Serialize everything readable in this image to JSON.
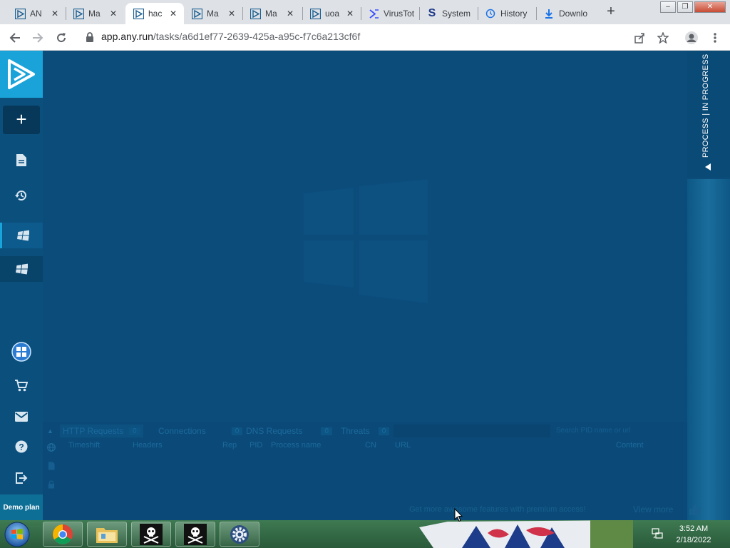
{
  "browser": {
    "tabs": [
      {
        "label": "AN",
        "icon": "anyrun-icon",
        "active": false
      },
      {
        "label": "Ma",
        "icon": "anyrun-icon",
        "active": false
      },
      {
        "label": "hac",
        "icon": "anyrun-icon",
        "active": true
      },
      {
        "label": "Ma",
        "icon": "anyrun-icon",
        "active": false
      },
      {
        "label": "Ma",
        "icon": "anyrun-icon",
        "active": false
      },
      {
        "label": "uoa",
        "icon": "anyrun-icon",
        "active": false
      },
      {
        "label": "VirusTot",
        "icon": "virustotal-icon",
        "active": false
      },
      {
        "label": "System",
        "icon": "s-icon",
        "active": false
      },
      {
        "label": "History",
        "icon": "history-icon",
        "active": false
      },
      {
        "label": "Downlo",
        "icon": "download-icon",
        "active": false
      }
    ],
    "tab_close_glyph": "✕",
    "new_tab_glyph": "+",
    "url_host": "app.any.run",
    "url_path": "/tasks/a6d1ef77-2639-425a-a95c-f7c6a213cf6f"
  },
  "app": {
    "accent_color": "#1aa3d9",
    "new_task_glyph": "+",
    "demo_plan": "Demo plan",
    "process_panel_label": "PROCESS | IN PROGRESS",
    "bottom_tabs": [
      {
        "label": "HTTP Requests",
        "count": "0"
      },
      {
        "label": "Connections",
        "count": "0"
      },
      {
        "label": "DNS Requests",
        "count": "0"
      },
      {
        "label": "Threats",
        "count": "0"
      }
    ],
    "search_placeholder": "Search PID name or url",
    "columns": [
      "Timeshift",
      "Headers",
      "Rep",
      "PID",
      "Process name",
      "CN",
      "URL",
      "Content"
    ],
    "premium_text": "Get more awesome features with premium access!",
    "view_more": "View more"
  },
  "taskbar": {
    "time": "3:52 AM",
    "date": "2/18/2022"
  }
}
